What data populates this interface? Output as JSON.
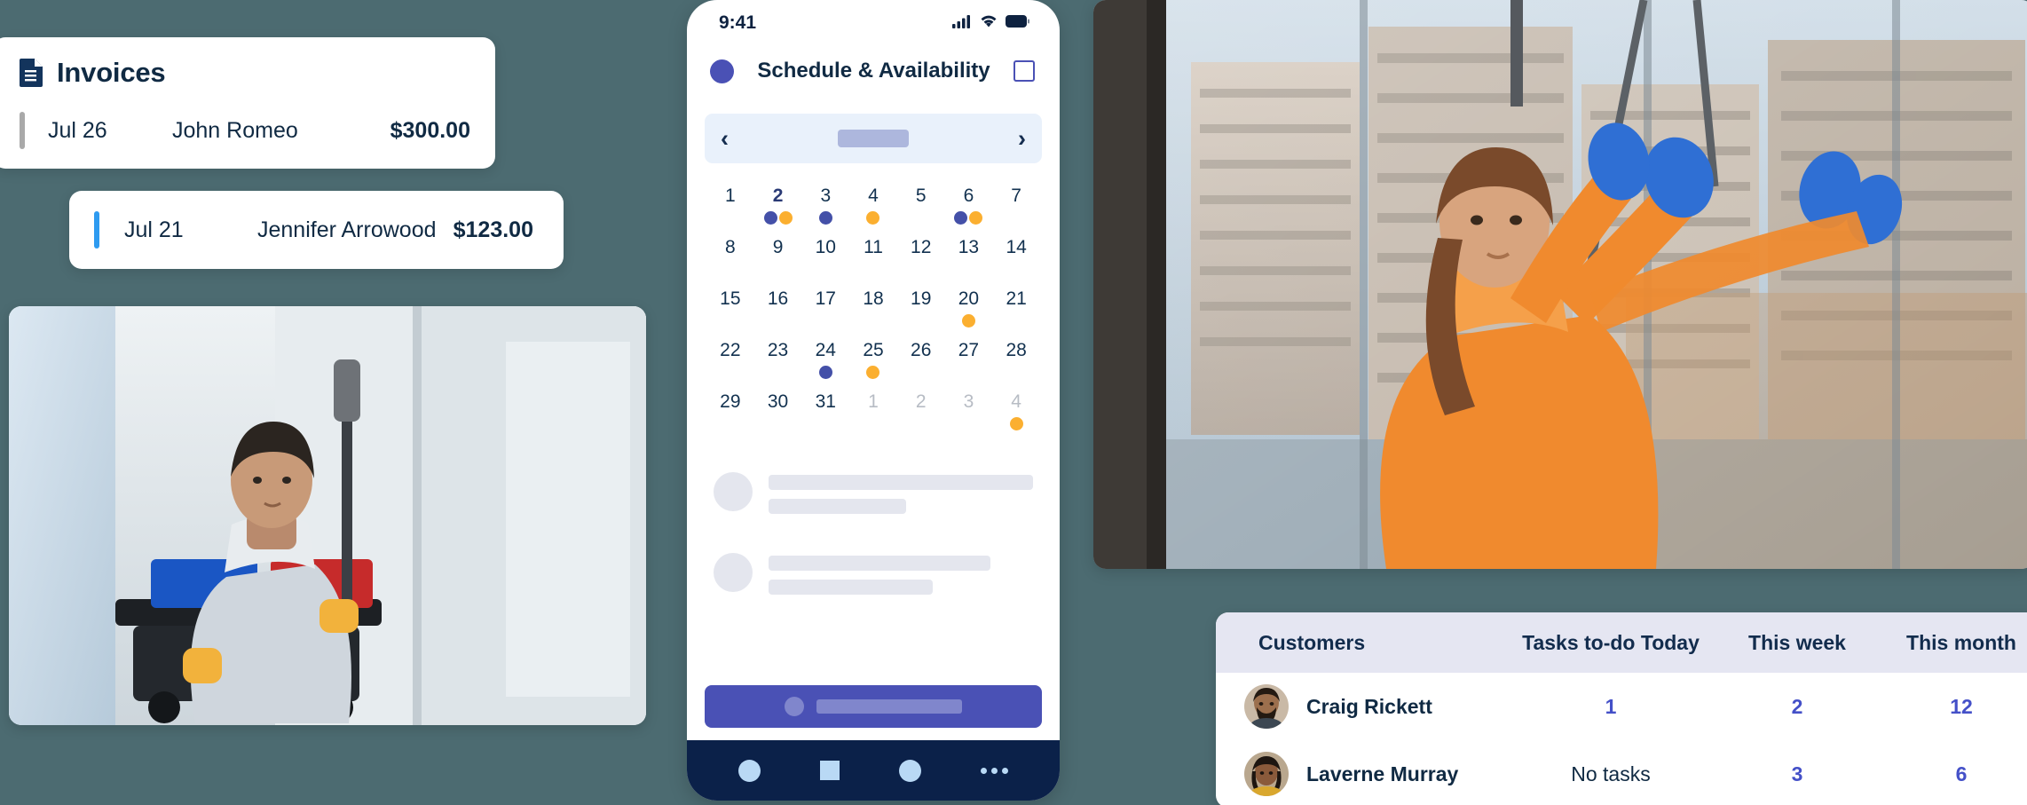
{
  "theme": {
    "background": "#4c6b71",
    "accent_blue": "#4450a8",
    "accent_amber": "#fbaf30",
    "navy": "#102a43",
    "link_blue": "#4450c8"
  },
  "invoices": {
    "icon": "document-icon",
    "title": "Invoices",
    "rows": [
      {
        "date": "Jul 26",
        "name": "John Romeo",
        "amount": "$300.00",
        "accent": "grey"
      },
      {
        "date": "Jul 21",
        "name": "Jennifer Arrowood",
        "amount": "$123.00",
        "accent": "blue"
      }
    ]
  },
  "phone": {
    "status": {
      "time": "9:41",
      "signal": "cellular-signal-icon",
      "wifi": "wifi-icon",
      "battery": "battery-icon"
    },
    "header": {
      "left_icon": "menu-dot-icon",
      "title": "Schedule & Availability",
      "right_icon": "square-outline-icon"
    },
    "calendar": {
      "prev_icon": "chevron-left-icon",
      "next_icon": "chevron-right-icon",
      "month_placeholder": "",
      "weekday_placeholders": [
        "",
        "",
        "",
        "",
        "",
        "",
        ""
      ],
      "selected_day": "2",
      "weeks": [
        [
          {
            "label": "1",
            "muted": false,
            "dots": []
          },
          {
            "label": "2",
            "muted": false,
            "selected": true,
            "dots": [
              "blue",
              "amber"
            ]
          },
          {
            "label": "3",
            "muted": false,
            "dots": [
              "blue"
            ]
          },
          {
            "label": "4",
            "muted": false,
            "dots": [
              "amber"
            ]
          },
          {
            "label": "5",
            "muted": false,
            "dots": []
          },
          {
            "label": "6",
            "muted": false,
            "dots": [
              "blue",
              "amber"
            ]
          },
          {
            "label": "7",
            "muted": false,
            "dots": []
          }
        ],
        [
          {
            "label": "8",
            "muted": false,
            "dots": []
          },
          {
            "label": "9",
            "muted": false,
            "dots": []
          },
          {
            "label": "10",
            "muted": false,
            "dots": []
          },
          {
            "label": "11",
            "muted": false,
            "dots": []
          },
          {
            "label": "12",
            "muted": false,
            "dots": []
          },
          {
            "label": "13",
            "muted": false,
            "dots": []
          },
          {
            "label": "14",
            "muted": false,
            "dots": []
          }
        ],
        [
          {
            "label": "15",
            "muted": false,
            "dots": []
          },
          {
            "label": "16",
            "muted": false,
            "dots": []
          },
          {
            "label": "17",
            "muted": false,
            "dots": []
          },
          {
            "label": "18",
            "muted": false,
            "dots": []
          },
          {
            "label": "19",
            "muted": false,
            "dots": []
          },
          {
            "label": "20",
            "muted": false,
            "dots": [
              "amber"
            ]
          },
          {
            "label": "21",
            "muted": false,
            "dots": []
          }
        ],
        [
          {
            "label": "22",
            "muted": false,
            "dots": []
          },
          {
            "label": "23",
            "muted": false,
            "dots": []
          },
          {
            "label": "24",
            "muted": false,
            "dots": [
              "blue"
            ]
          },
          {
            "label": "25",
            "muted": false,
            "dots": [
              "amber"
            ]
          },
          {
            "label": "26",
            "muted": false,
            "dots": []
          },
          {
            "label": "27",
            "muted": false,
            "dots": []
          },
          {
            "label": "28",
            "muted": false,
            "dots": []
          }
        ],
        [
          {
            "label": "29",
            "muted": false,
            "dots": []
          },
          {
            "label": "30",
            "muted": false,
            "dots": []
          },
          {
            "label": "31",
            "muted": false,
            "dots": []
          },
          {
            "label": "1",
            "muted": true,
            "dots": []
          },
          {
            "label": "2",
            "muted": true,
            "dots": []
          },
          {
            "label": "3",
            "muted": true,
            "dots": []
          },
          {
            "label": "4",
            "muted": true,
            "dots": [
              "amber"
            ]
          }
        ]
      ]
    },
    "skeleton_rows": [
      {
        "line1_width": "100%",
        "line2_width": "52%"
      },
      {
        "line1_width": "84%",
        "line2_width": "62%"
      }
    ],
    "cta": {
      "label": ""
    },
    "nav": [
      {
        "icon": "circle-nav-icon"
      },
      {
        "icon": "square-nav-icon"
      },
      {
        "icon": "circle-nav-icon"
      },
      {
        "icon": "more-dots-nav-icon"
      }
    ]
  },
  "photos": {
    "cleaner": {
      "alt": "housekeeper-with-cleaning-cart-photo"
    },
    "window_cleaner": {
      "alt": "window-cleaner-at-glass-facade-photo"
    }
  },
  "customers_table": {
    "columns": [
      "Customers",
      "Tasks to-do Today",
      "This week",
      "This month"
    ],
    "rows": [
      {
        "avatar": "avatar-craig",
        "name": "Craig Rickett",
        "today": "1",
        "week": "2",
        "month": "12",
        "today_is_text": false
      },
      {
        "avatar": "avatar-laverne",
        "name": "Laverne Murray",
        "today": "No tasks",
        "week": "3",
        "month": "6",
        "today_is_text": true
      }
    ]
  }
}
